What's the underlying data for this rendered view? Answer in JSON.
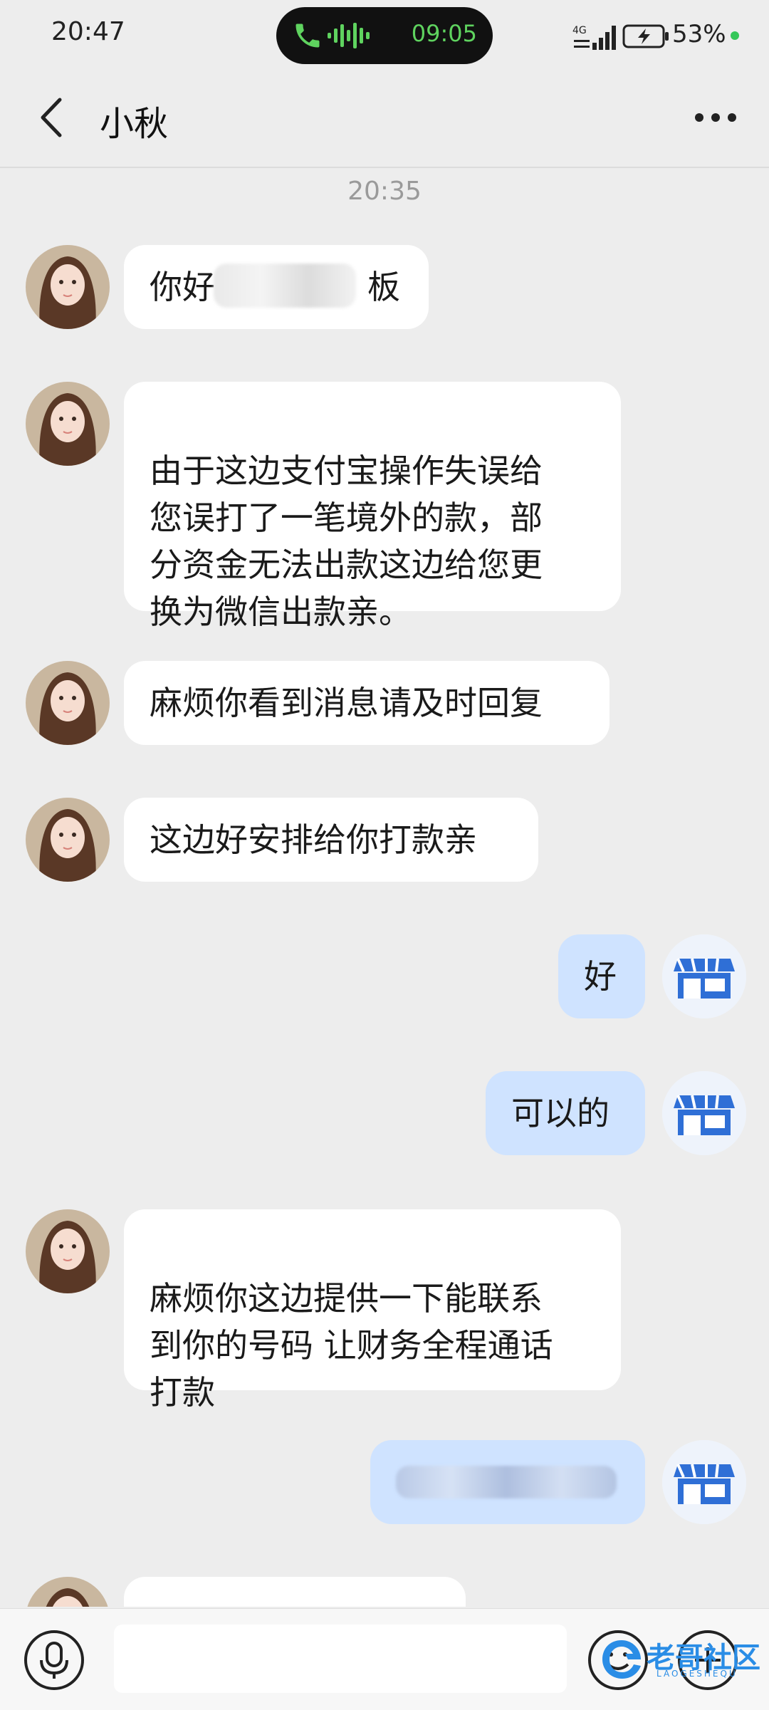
{
  "status_bar": {
    "time": "20:47",
    "call_duration": "09:05",
    "network": "4G",
    "battery": "53%"
  },
  "header": {
    "title": "小秋",
    "back_icon": "chevron-left-icon",
    "more_icon": "more-horizontal-icon"
  },
  "chat": {
    "timestamp": "20:35",
    "messages": [
      {
        "side": "left",
        "text": "你好"
      },
      {
        "side": "left",
        "text": "由于这边支付宝操作失误给\n您误打了一笔境外的款，部\n分资金无法出款这边给您更\n换为微信出款亲。"
      },
      {
        "side": "left",
        "text": "麻烦你看到消息请及时回复"
      },
      {
        "side": "left",
        "text": "这边好安排给你打款亲"
      },
      {
        "side": "right",
        "text": "好"
      },
      {
        "side": "right",
        "text": "可以的"
      },
      {
        "side": "left",
        "text": "麻烦你这边提供一下能联系\n到你的号码 让财务全程通话\n打款"
      },
      {
        "side": "right",
        "text": ""
      },
      {
        "side": "left",
        "text": ""
      }
    ],
    "msg1_suffix": "板"
  },
  "bottom_bar": {
    "voice_icon": "microphone-icon",
    "emoji_icon": "emoji-icon",
    "plus_icon": "plus-icon",
    "input_value": ""
  },
  "watermark": {
    "text": "老哥社区",
    "sub": "LAOGESHEQU"
  },
  "colors": {
    "background": "#ededed",
    "bubble_left": "#ffffff",
    "bubble_right": "#cfe3ff",
    "call_green": "#5fd35f"
  }
}
